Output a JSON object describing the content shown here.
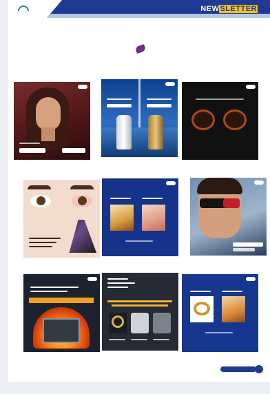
{
  "header": {
    "logo_text": "",
    "newsletter_pre": "NEW",
    "newsletter_hl": "SLETTER",
    "colors": {
      "brand_blue": "#1f3a93",
      "accent_yellow": "#f2c11b",
      "title_pink": "#c2185b"
    }
  },
  "section": {
    "title": ""
  },
  "footer": {
    "page_number": "",
    "side_text": ""
  }
}
